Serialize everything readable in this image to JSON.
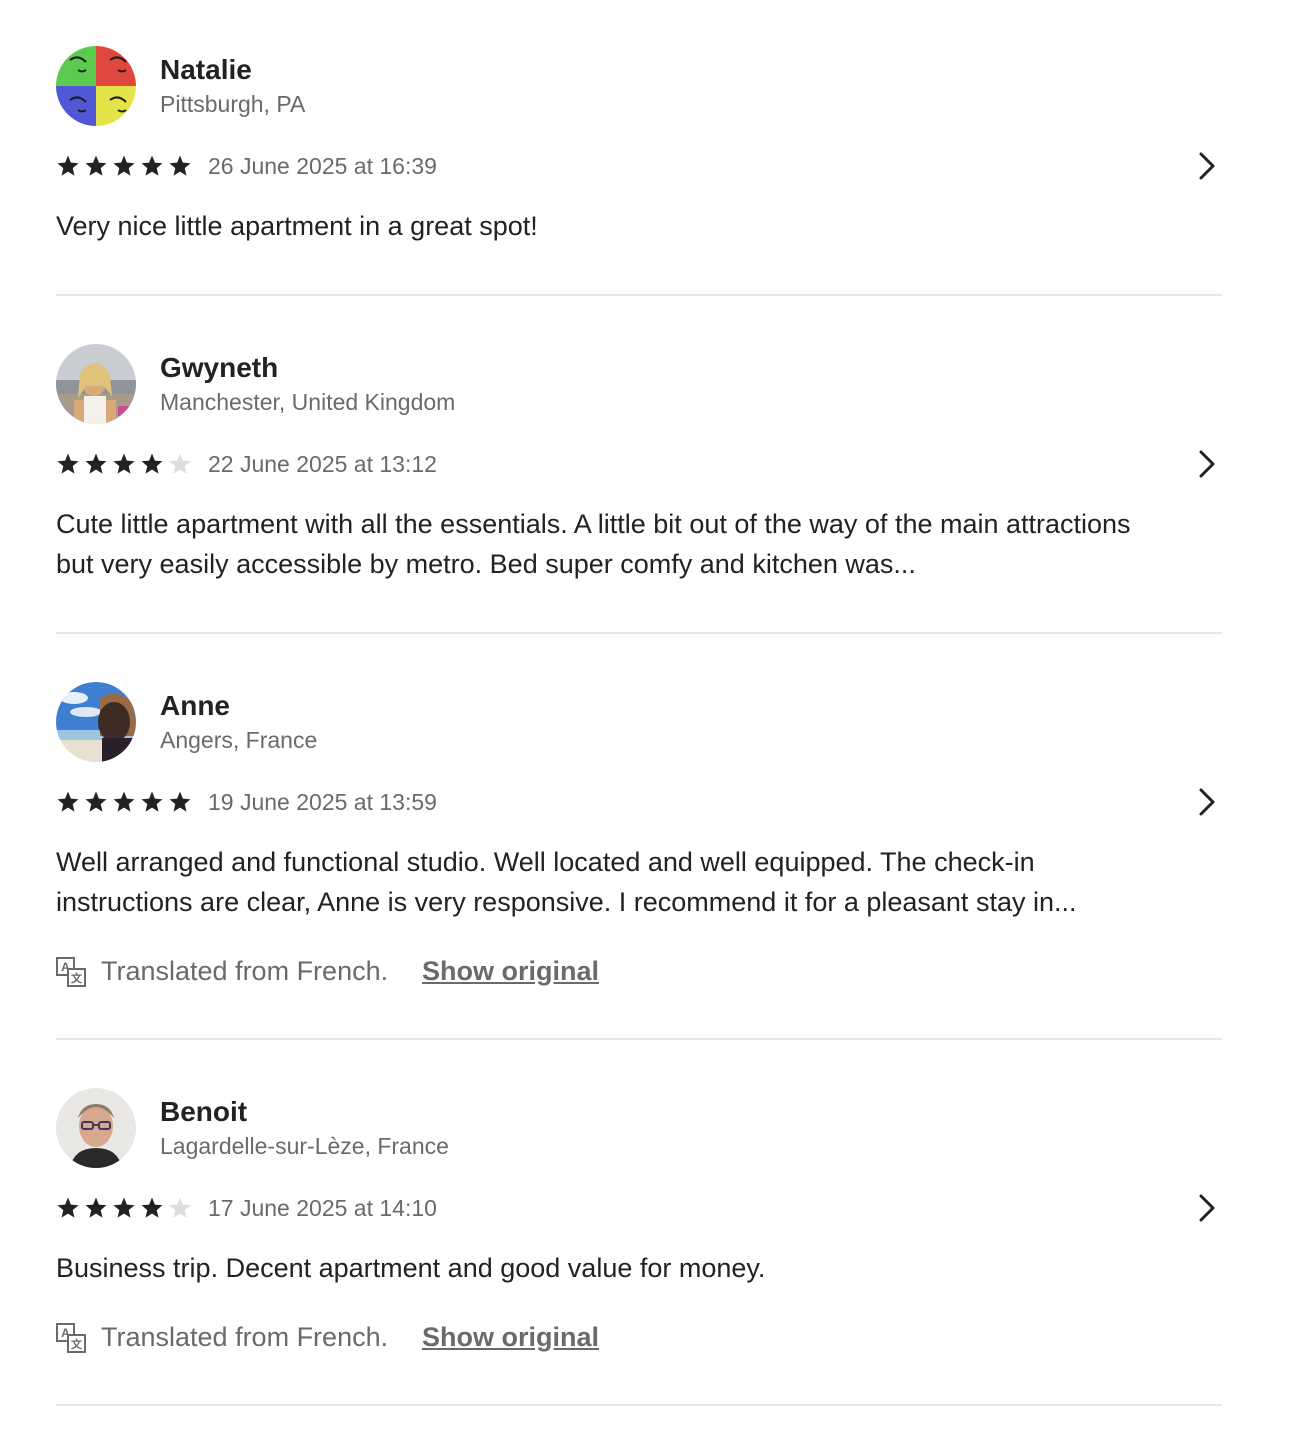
{
  "reviews": [
    {
      "name": "Natalie",
      "location": "Pittsburgh, PA",
      "rating": 5,
      "date": "26 June 2025 at 16:39",
      "text": "Very nice little apartment in a great spot!",
      "avatar_icon": "pop-art-portrait-avatar"
    },
    {
      "name": "Gwyneth",
      "location": "Manchester, United Kingdom",
      "rating": 4,
      "date": "22 June 2025 at 13:12",
      "text": "Cute little apartment with all the essentials. A little bit out of the way of the main attractions but very easily accessible by metro. Bed super comfy and kitchen was...",
      "avatar_icon": "beach-portrait-avatar"
    },
    {
      "name": "Anne",
      "location": "Angers, France",
      "rating": 5,
      "date": "19 June 2025 at 13:59",
      "text": "Well arranged and functional studio. Well located and well equipped. The check-in instructions are clear, Anne is very responsive. I recommend it for a pleasant stay in...",
      "translation_label": "Translated from French.",
      "show_original_label": "Show original",
      "avatar_icon": "sky-selfie-avatar"
    },
    {
      "name": "Benoit",
      "location": "Lagardelle-sur-Lèze, France",
      "rating": 4,
      "date": "17 June 2025 at 14:10",
      "text": "Business trip. Decent apartment and good value for money.",
      "translation_label": "Translated from French.",
      "show_original_label": "Show original",
      "avatar_icon": "man-with-glasses-avatar"
    }
  ],
  "colors": {
    "text_primary": "#222222",
    "text_secondary": "#6a6a6a",
    "star_filled": "#222222",
    "star_empty": "#dddddd",
    "divider": "#e6e6e6"
  },
  "icons": {
    "star": "star-icon",
    "chevron": "chevron-right-icon",
    "translate": "translate-icon"
  }
}
